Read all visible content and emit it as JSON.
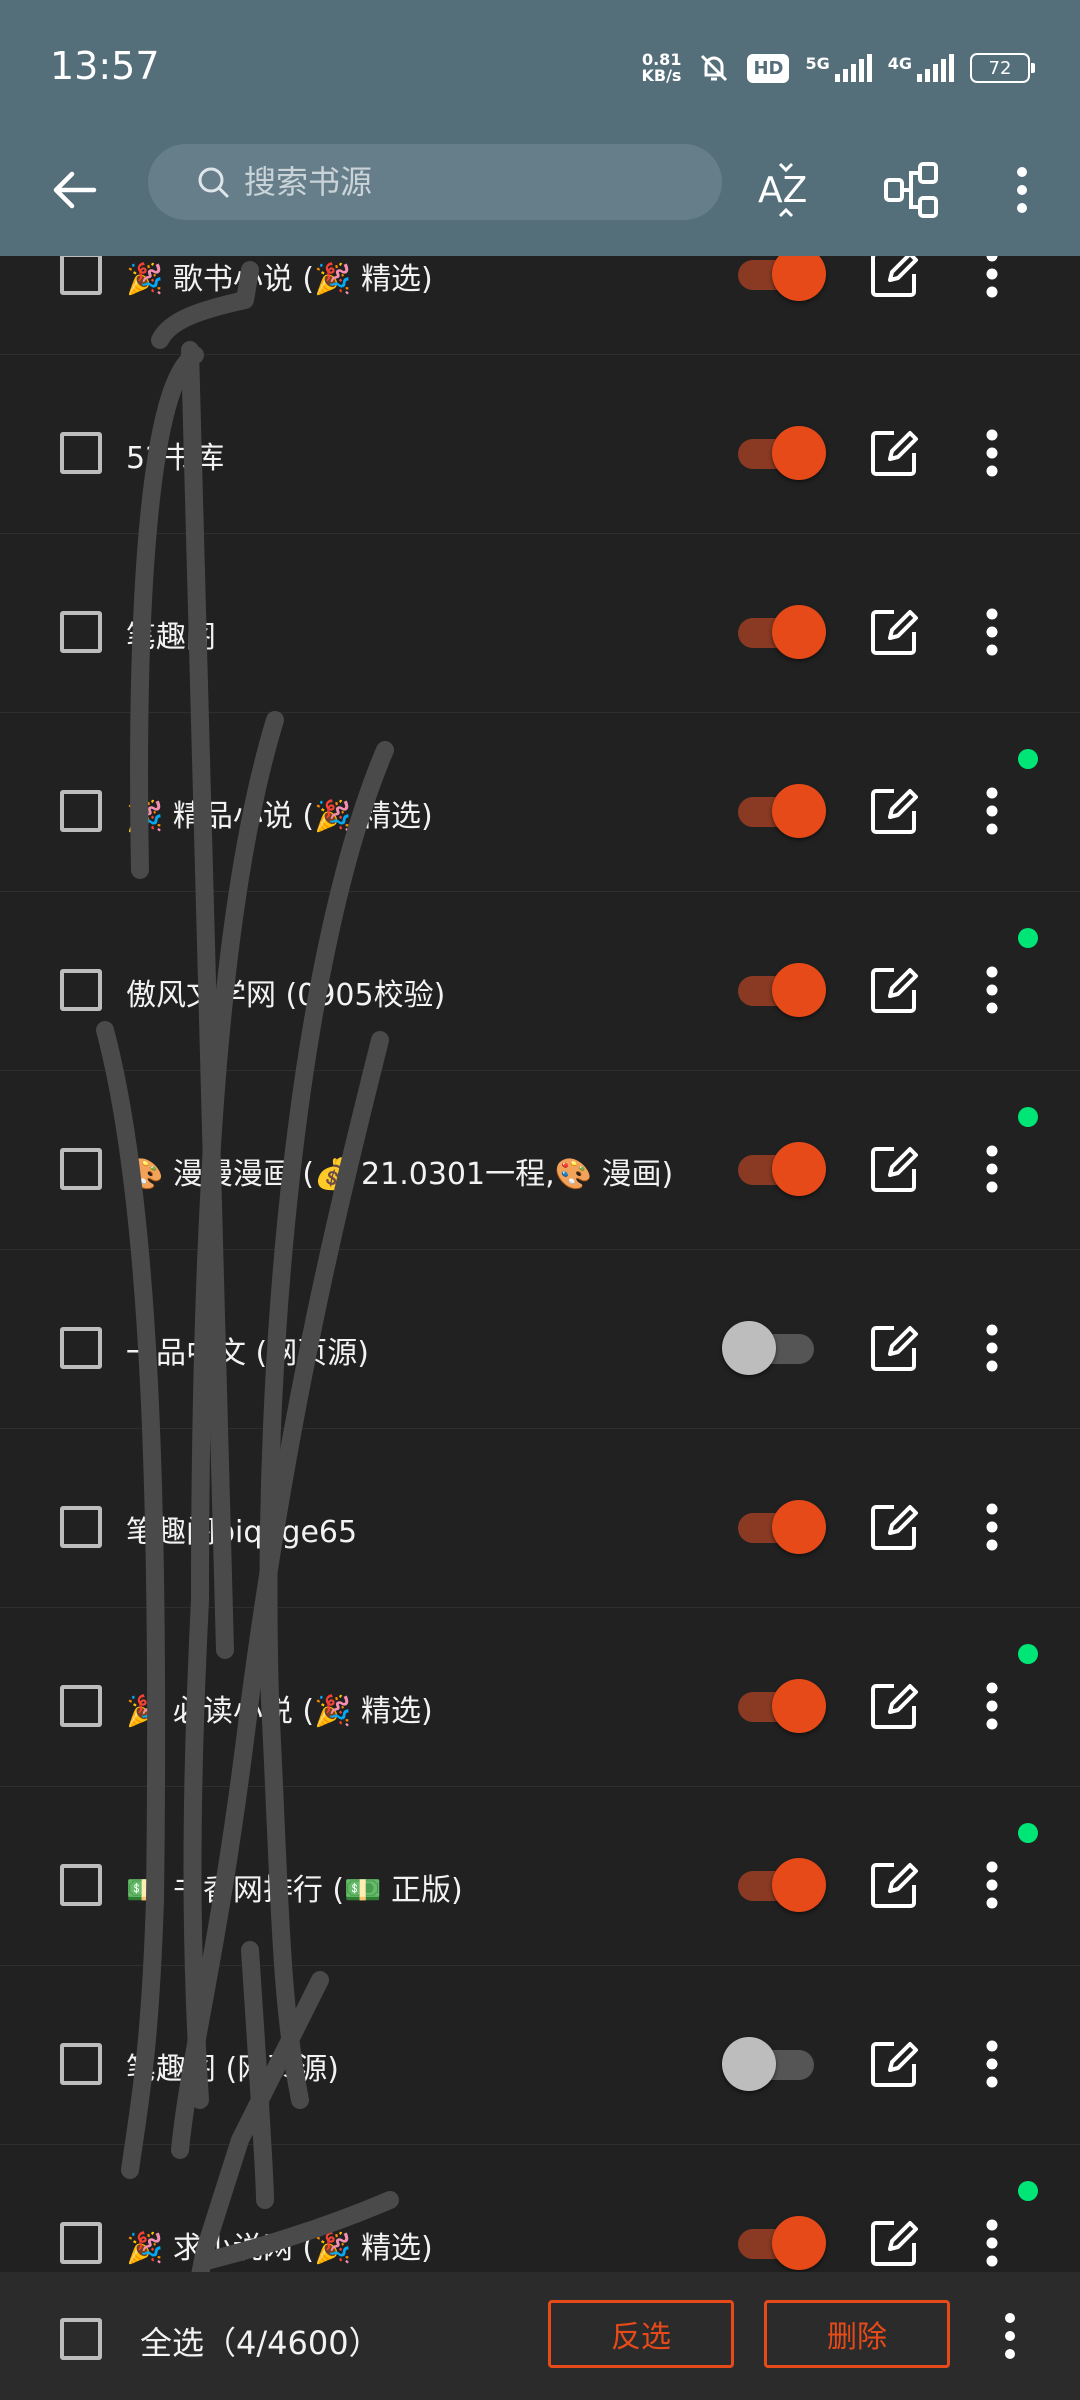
{
  "status_bar": {
    "time": "13:57",
    "net_speed_value": "0.81",
    "net_speed_unit": "KB/s",
    "hd_badge": "HD",
    "sim1_label": "5G",
    "sim2_label": "4G",
    "battery": "72"
  },
  "toolbar": {
    "search_placeholder": "搜索书源",
    "sort_icon_label": "AZ"
  },
  "sources": [
    {
      "name": "🎉 歌书小说 (🎉 精选)",
      "enabled": true,
      "dot": false
    },
    {
      "name": "52书库",
      "enabled": true,
      "dot": false
    },
    {
      "name": "笔趣阁",
      "enabled": true,
      "dot": false
    },
    {
      "name": "🎉 精品小说 (🎉 精选)",
      "enabled": true,
      "dot": true
    },
    {
      "name": "傲风文学网 (0905校验)",
      "enabled": true,
      "dot": true
    },
    {
      "name": "🎨 漫漫漫画 (💰 21.0301一程,🎨 漫画)",
      "enabled": true,
      "dot": true
    },
    {
      "name": "一品中文 (网页源)",
      "enabled": false,
      "dot": false
    },
    {
      "name": "笔趣阁biquge65",
      "enabled": true,
      "dot": false
    },
    {
      "name": "🎉 必读小说 (🎉 精选)",
      "enabled": true,
      "dot": true
    },
    {
      "name": "💵 书香网排行 (💵 正版)",
      "enabled": true,
      "dot": true
    },
    {
      "name": "笔趣阁 (网页源)",
      "enabled": false,
      "dot": false
    },
    {
      "name": "🎉 求小说网 (🎉 精选)",
      "enabled": true,
      "dot": true
    }
  ],
  "bottom": {
    "select_all": "全选（4/4600）",
    "invert_label": "反选",
    "delete_label": "删除"
  },
  "colors": {
    "toolbar_bg": "#546e7a",
    "list_bg": "#212121",
    "accent": "#e64a19",
    "dot": "#00e676"
  }
}
